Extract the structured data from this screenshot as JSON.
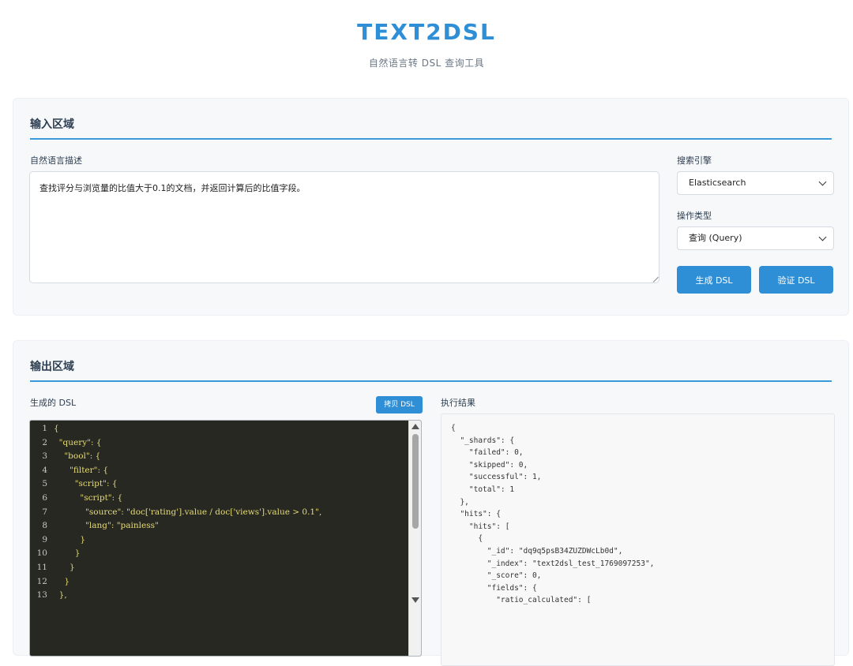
{
  "header": {
    "title": "TEXT2DSL",
    "subtitle": "自然语言转 DSL 查询工具"
  },
  "input_panel": {
    "title": "输入区域",
    "nl_label": "自然语言描述",
    "nl_value": "查找评分与浏览量的比值大于0.1的文档，并返回计算后的比值字段。",
    "engine_label": "搜索引擎",
    "engine_value": "Elasticsearch",
    "op_label": "操作类型",
    "op_value": "查询 (Query)",
    "generate_button": "生成 DSL",
    "validate_button": "验证 DSL"
  },
  "output_panel": {
    "title": "输出区域",
    "dsl_label": "生成的 DSL",
    "copy_button": "拷贝 DSL",
    "result_label": "执行结果",
    "dsl_lines": [
      "{",
      "  \"query\": {",
      "    \"bool\": {",
      "      \"filter\": {",
      "        \"script\": {",
      "          \"script\": {",
      "            \"source\": \"doc['rating'].value / doc['views'].value > 0.1\",",
      "            \"lang\": \"painless\"",
      "          }",
      "        }",
      "      }",
      "    }",
      "  },"
    ],
    "result_text": "{\n  \"_shards\": {\n    \"failed\": 0,\n    \"skipped\": 0,\n    \"successful\": 1,\n    \"total\": 1\n  },\n  \"hits\": {\n    \"hits\": [\n      {\n        \"_id\": \"dq9q5psB34ZUZDWcLb0d\",\n        \"_index\": \"text2dsl_test_1769097253\",\n        \"_score\": 0,\n        \"fields\": {\n          \"ratio_calculated\": ["
  },
  "colors": {
    "accent": "#2f8fd6",
    "code_bg": "#272822",
    "code_string": "#e6db74"
  }
}
